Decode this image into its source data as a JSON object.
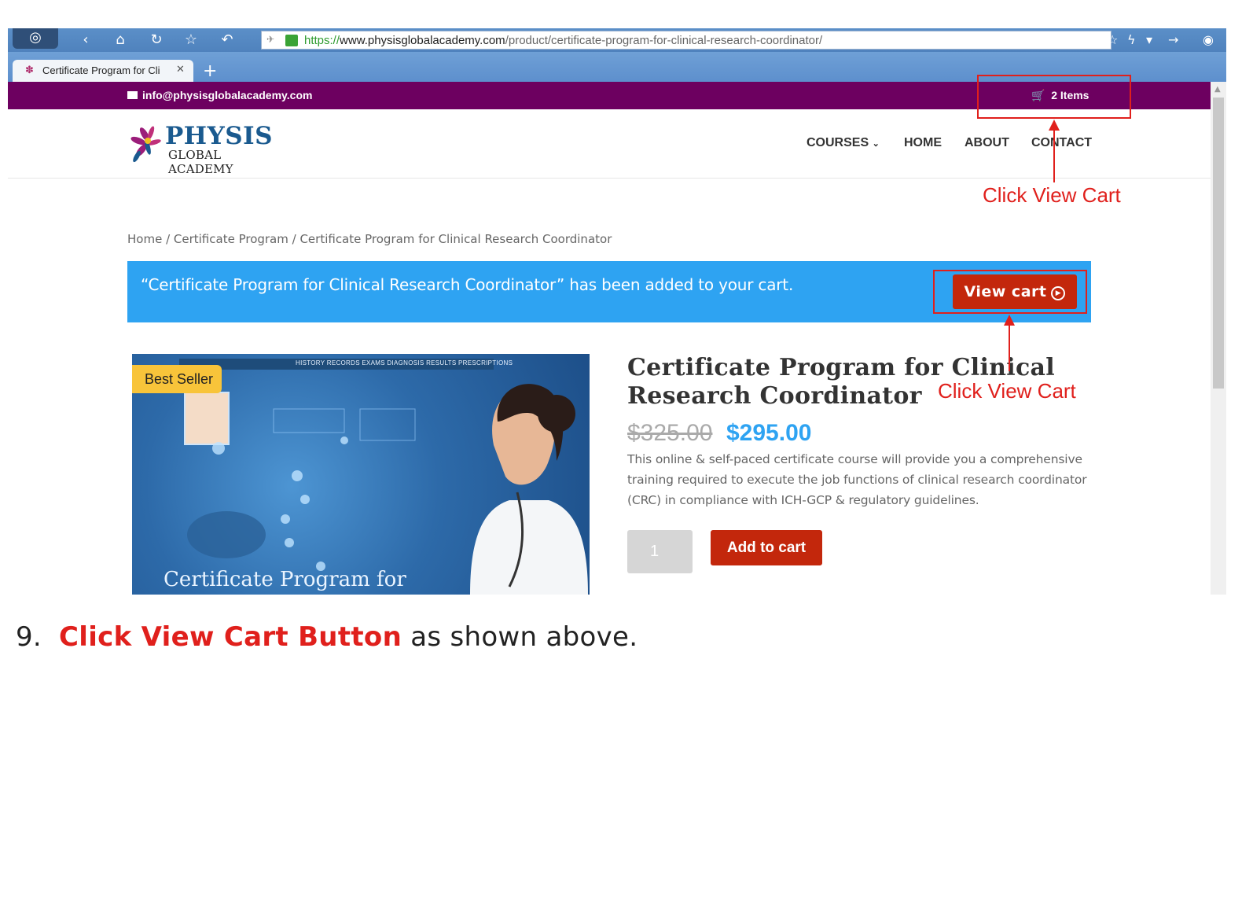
{
  "browser": {
    "url_protocol": "https://",
    "url_host": "www.physisglobalacademy.com",
    "url_path": "/product/certificate-program-for-clinical-research-coordinator/",
    "tab_title": "Certificate Program for Cli",
    "icons": [
      "app-logo-icon",
      "back-icon",
      "home-icon",
      "reload-icon",
      "star-icon",
      "undo-icon",
      "lock-icon",
      "bookmark-icon",
      "lightning-icon",
      "forward-icon",
      "wifi-icon"
    ]
  },
  "site": {
    "email": "info@physisglobalacademy.com",
    "cart_label": "2 Items",
    "logo_name": "PHYSIS",
    "logo_sub": "GLOBAL ACADEMY",
    "nav": {
      "courses": "COURSES",
      "home": "HOME",
      "about": "ABOUT",
      "contact": "CONTACT"
    },
    "breadcrumb": "Home / Certificate Program / Certificate Program for Clinical Research Coordinator",
    "notice": {
      "message": "“Certificate Program for Clinical Research Coordinator” has been added to your cart.",
      "button": "View cart"
    },
    "product": {
      "badge": "Best Seller",
      "image_caption": "Certificate Program for",
      "image_strip": "HISTORY  RECORDS  EXAMS  DIAGNOSIS  RESULTS  PRESCRIPTIONS",
      "title": "Certificate Program for Clinical Research Coordinator",
      "price_old": "$325.00",
      "price_new": "$295.00",
      "description": "This online & self-paced certificate course will provide you a comprehensive training required to execute the job functions of clinical research coordinator (CRC) in compliance with ICH-GCP & regulatory guidelines.",
      "quantity": "1",
      "add_to_cart": "Add to cart"
    }
  },
  "annotations": {
    "label_top": "Click View Cart",
    "label_bottom": "Click View Cart",
    "color": "#e0201c"
  },
  "instruction": {
    "number": "9.",
    "strong": "Click View Cart Button",
    "rest": " as shown above."
  }
}
